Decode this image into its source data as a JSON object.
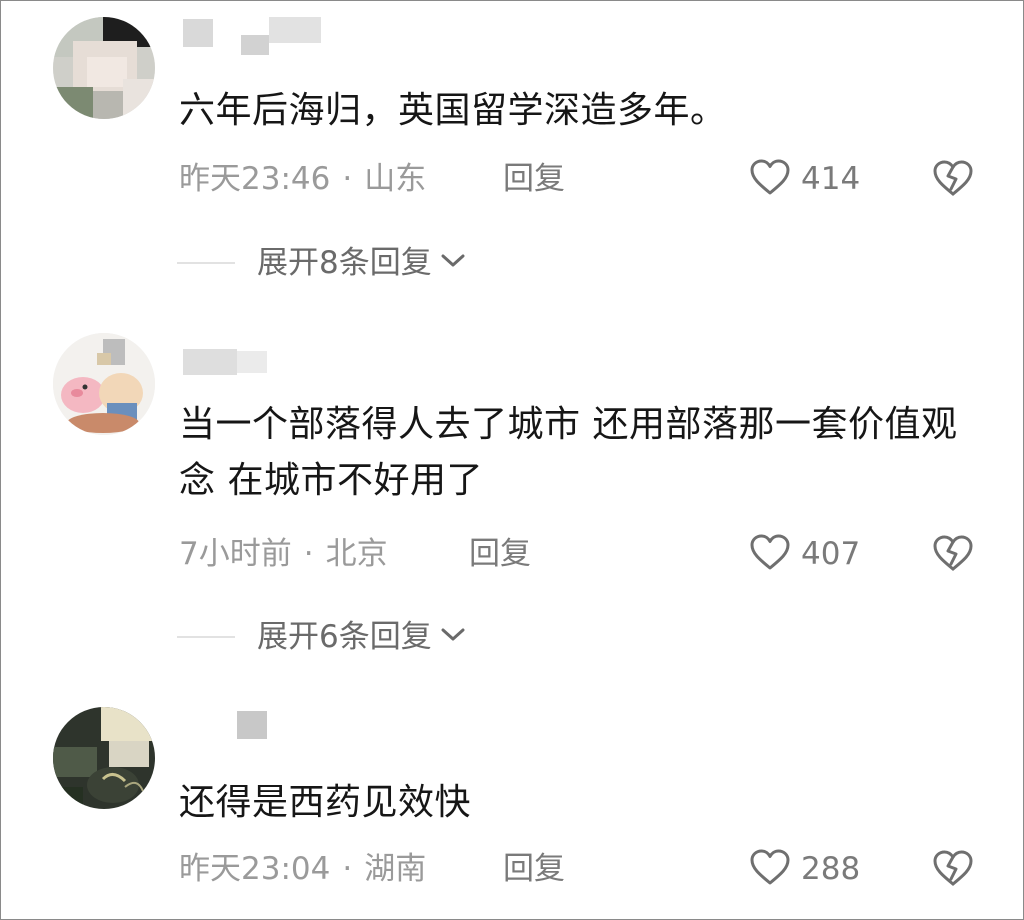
{
  "comments": [
    {
      "text": "六年后海归，英国留学深造多年。",
      "time": "昨天23:46",
      "separator": "·",
      "location": "山东",
      "reply_label": "回复",
      "likes": "414",
      "expand_label": "展开8条回复"
    },
    {
      "text": "当一个部落得人去了城市 还用部落那一套价值观念 在城市不好用了",
      "time": "7小时前",
      "separator": "·",
      "location": "北京",
      "reply_label": "回复",
      "likes": "407",
      "expand_label": "展开6条回复"
    },
    {
      "text": "还得是西药见效快",
      "time": "昨天23:04",
      "separator": "·",
      "location": "湖南",
      "reply_label": "回复",
      "likes": "288"
    }
  ],
  "icons": {
    "like": "heart-outline-icon",
    "dislike": "broken-heart-icon",
    "expand": "chevron-down-icon"
  },
  "colors": {
    "text_primary": "#161616",
    "text_meta": "#9a9a9a",
    "text_secondary": "#7a7a7a"
  }
}
